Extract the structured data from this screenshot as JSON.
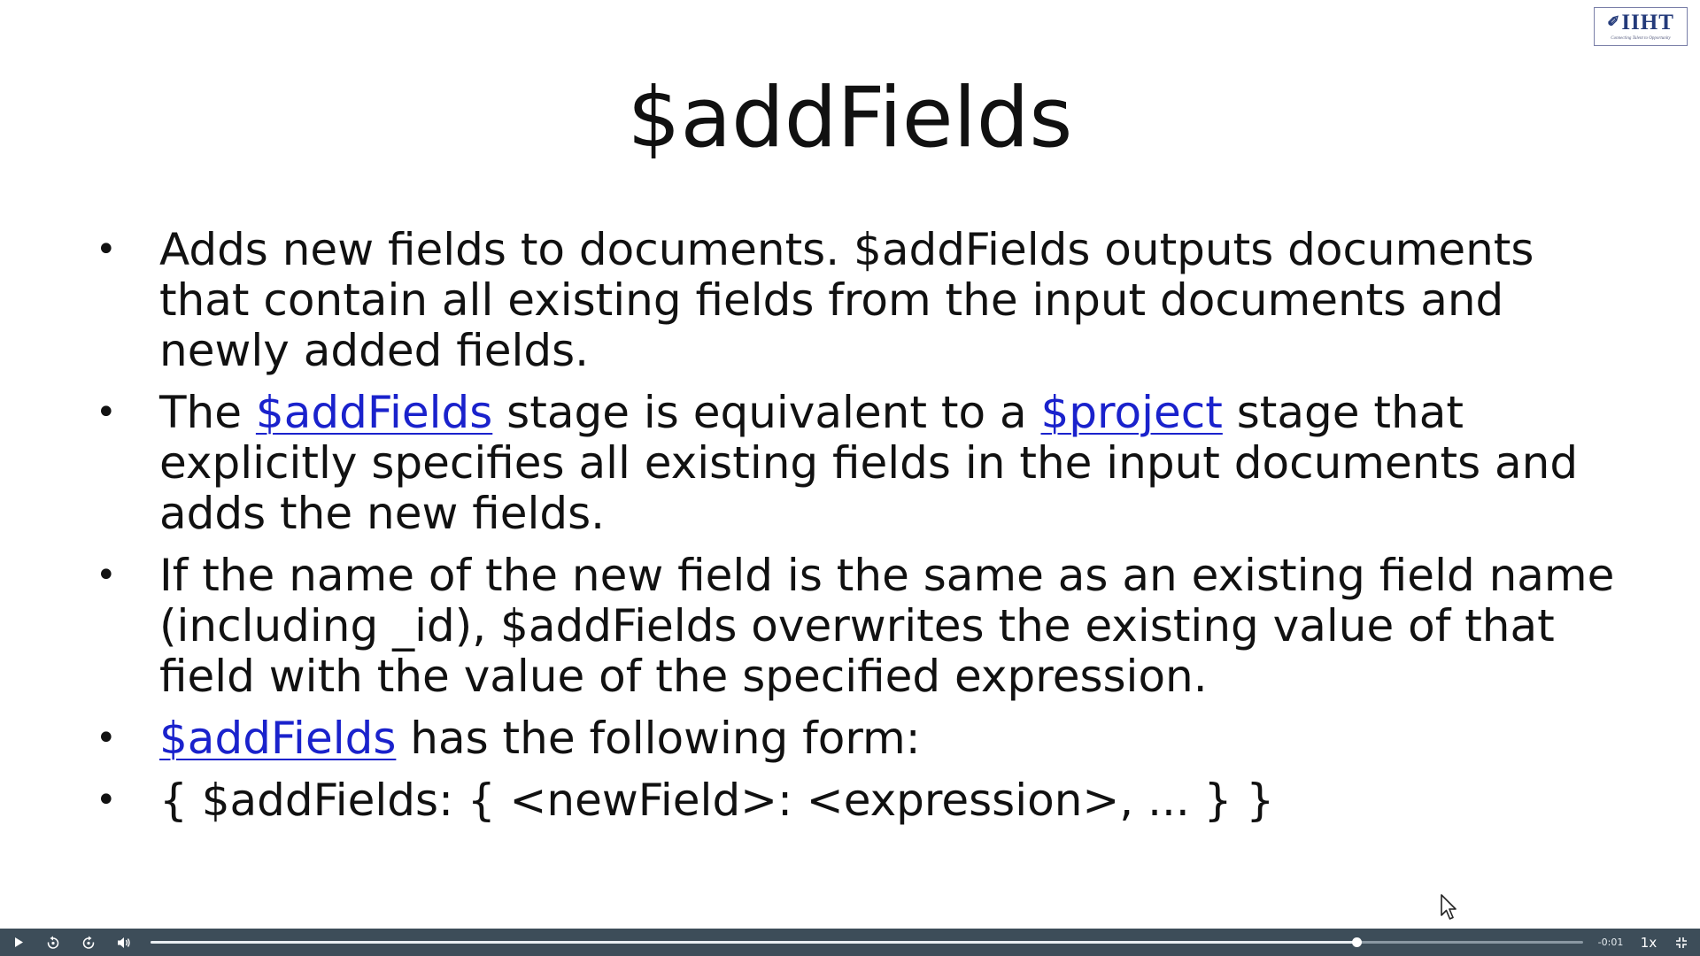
{
  "slide": {
    "title": "$addFields",
    "logo": {
      "text": "IIHT",
      "tagline": "Connecting Talent to Opportunity"
    },
    "bullets": [
      {
        "segments": [
          {
            "text": "Adds new fields to documents. $addFields outputs documents that contain all existing fields from the input documents and newly added fields.",
            "link": false
          }
        ]
      },
      {
        "segments": [
          {
            "text": "The ",
            "link": false
          },
          {
            "text": "$addFields",
            "link": true
          },
          {
            "text": " stage is equivalent to a ",
            "link": false
          },
          {
            "text": "$project",
            "link": true
          },
          {
            "text": " stage that explicitly specifies all existing fields in the input documents and adds the new fields.",
            "link": false
          }
        ]
      },
      {
        "segments": [
          {
            "text": "If the name of the new field is the same as an existing field name (including _id), $addFields overwrites the existing value of that field with the value of the specified expression.",
            "link": false
          }
        ]
      },
      {
        "segments": [
          {
            "text": "$addFields",
            "link": true
          },
          {
            "text": " has the following form:",
            "link": false
          }
        ]
      },
      {
        "segments": [
          {
            "text": "{ $addFields: { <newField>: <expression>, ... } }",
            "link": false
          }
        ]
      }
    ]
  },
  "player": {
    "time_remaining": "-0:01",
    "speed": "1x",
    "progress": 0.842,
    "icons": {
      "play": "play-icon",
      "rewind": "rewind-10-icon",
      "forward": "forward-10-icon",
      "volume": "volume-icon",
      "fullscreen": "exit-fullscreen-icon"
    }
  },
  "colors": {
    "link": "#1a22cc",
    "player_bar": "#3d4d59",
    "logo": "#233a7a"
  }
}
